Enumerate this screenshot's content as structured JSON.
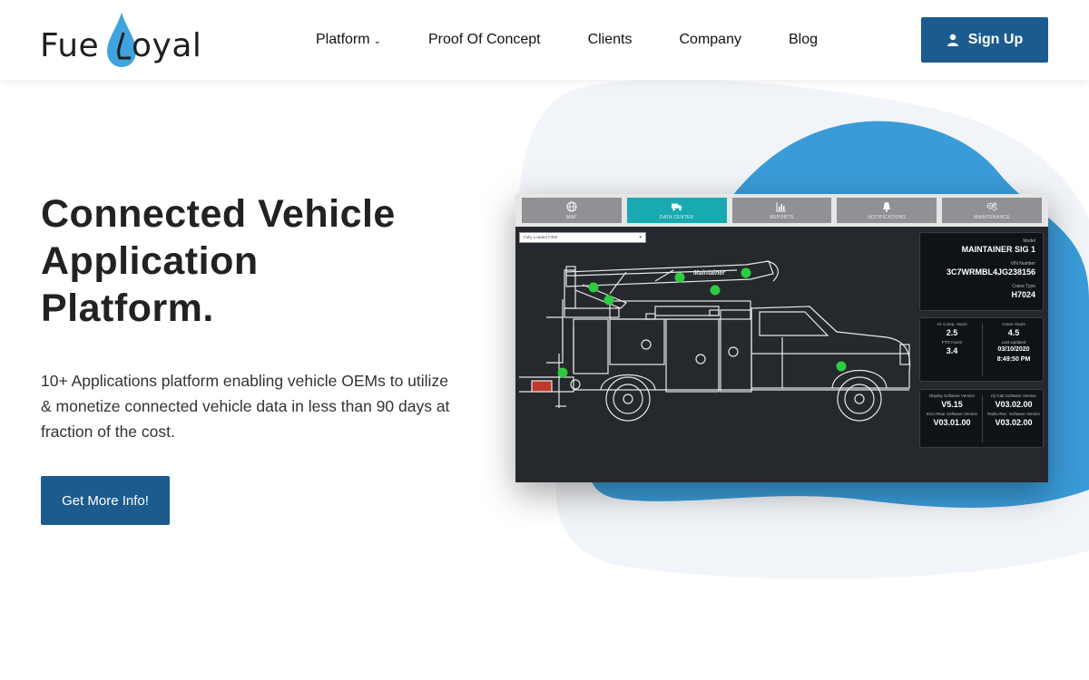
{
  "brand": {
    "name": "FuelLoyal",
    "accent": "#1c5b8e",
    "drop_color": "#3ea3df"
  },
  "nav": {
    "items": [
      {
        "label": "Platform",
        "has_dropdown": true
      },
      {
        "label": "Proof Of Concept"
      },
      {
        "label": "Clients"
      },
      {
        "label": "Company"
      },
      {
        "label": "Blog"
      }
    ],
    "signup_label": "Sign Up"
  },
  "hero": {
    "title_lines": [
      "Connected Vehicle",
      "Application",
      "Platform."
    ],
    "description": "10+ Applications platform enabling vehicle OEMs to utilize & monetize connected vehicle data in less than 90 days at fraction of the cost.",
    "cta_label": "Get More Info!"
  },
  "dashboard": {
    "tabs": [
      {
        "label": "MAP",
        "icon": "globe-icon",
        "active": false
      },
      {
        "label": "DATA CENTER",
        "icon": "truck-icon",
        "active": true
      },
      {
        "label": "REPORTS",
        "icon": "bar-chart-icon",
        "active": false
      },
      {
        "label": "NOTIFICATIONS",
        "icon": "bell-icon",
        "active": false
      },
      {
        "label": "MAINTENANCE",
        "icon": "gears-icon",
        "active": false
      }
    ],
    "select_value": "Fully Loaded F350",
    "truck_brand": "Maintainer",
    "model_label": "Model",
    "model_value": "MAINTAINER SIG 1",
    "vin_label": "VIN Number",
    "vin_value": "3C7WRMBL4JG238156",
    "crane_type_label": "Crane Type",
    "crane_type_value": "H7024",
    "air_comp_label": "Air Comp. Hours",
    "air_comp_value": "2.5",
    "pto_label": "PTO Hours",
    "pto_value": "3.4",
    "crane_hours_label": "Crane Hours",
    "crane_hours_value": "4.5",
    "last_updated_label": "Last Updated",
    "last_updated_date": "03/10/2020",
    "last_updated_time": "8:49:50 PM",
    "display_sw_label": "Display Software Version",
    "display_sw_value": "V5.15",
    "ecu_sw_label": "ECU-Rear Software Version",
    "ecu_sw_value": "V03.01.00",
    "cab_sw_label": "IQ-Cab Software Version",
    "cab_sw_value": "V03.02.00",
    "radio_sw_label": "Radio-Rec. Software Version",
    "radio_sw_value": "V03.02.00",
    "sensor_color": "#2ecc40"
  }
}
